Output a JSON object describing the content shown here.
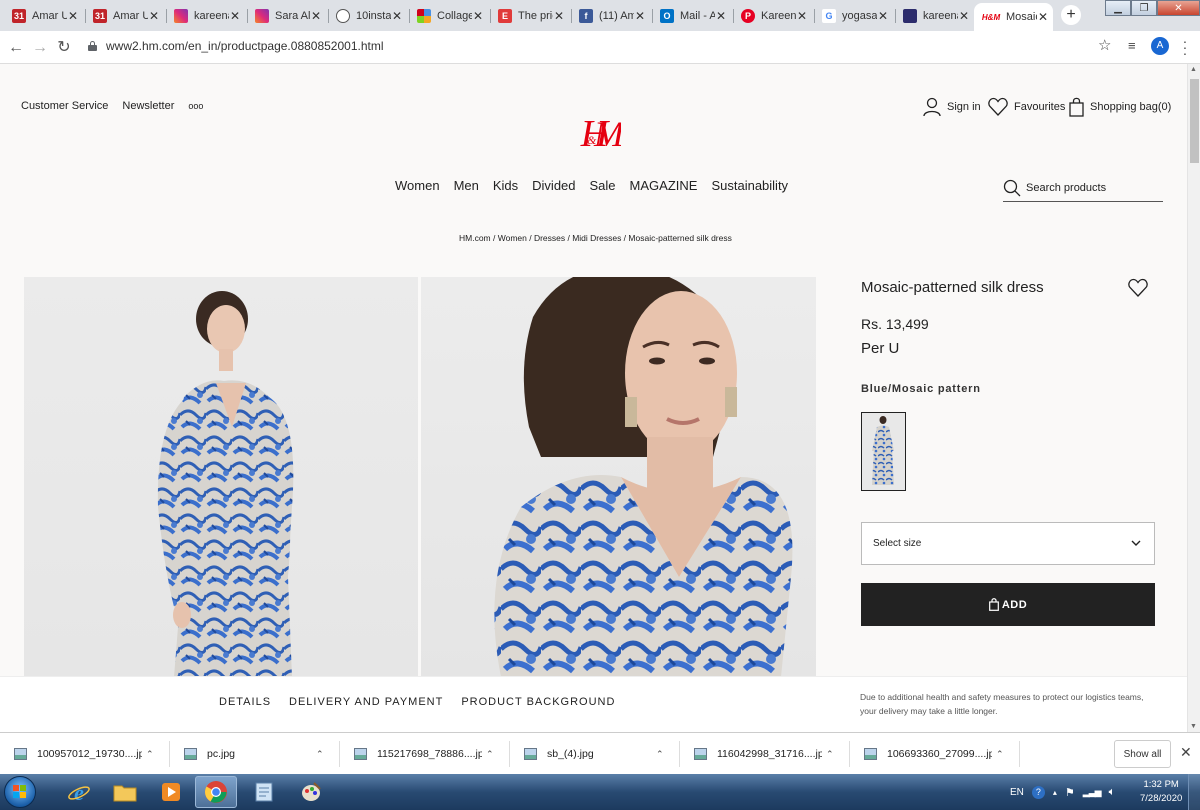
{
  "browser": {
    "tabs": [
      {
        "title": "Amar Uj",
        "fav": "31",
        "favcolor": "#c0242a"
      },
      {
        "title": "Amar Uj",
        "fav": "31",
        "favcolor": "#c0242a"
      },
      {
        "title": "kareena",
        "fav": "",
        "favcolor": "#c13584"
      },
      {
        "title": "Sara Ali",
        "fav": "",
        "favcolor": "#c13584"
      },
      {
        "title": "10insta",
        "fav": "",
        "favcolor": "#555555"
      },
      {
        "title": "Collage",
        "fav": "",
        "favcolor": "#4a90e2"
      },
      {
        "title": "The pric",
        "fav": "E",
        "favcolor": "#e03a3a"
      },
      {
        "title": "(11) Am",
        "fav": "f",
        "favcolor": "#3b5998"
      },
      {
        "title": "Mail - A",
        "fav": "O",
        "favcolor": "#0072c6"
      },
      {
        "title": "Kareena",
        "fav": "P",
        "favcolor": "#e60023"
      },
      {
        "title": "yogasan",
        "fav": "G",
        "favcolor": "#ffffff"
      },
      {
        "title": "kareena",
        "fav": "",
        "favcolor": "#2c2c6c"
      },
      {
        "title": "Mosaic-",
        "fav": "H&M",
        "favcolor": "#ffffff"
      }
    ],
    "url": "www2.hm.com/en_in/productpage.0880852001.html",
    "profile_initial": "A"
  },
  "header": {
    "customer_service": "Customer Service",
    "newsletter": "Newsletter",
    "more": "ooo",
    "logo_alt": "H&M",
    "sign_in": "Sign in",
    "favourites": "Favourites",
    "shopping_bag": "Shopping bag(0)"
  },
  "nav": {
    "items": [
      "Women",
      "Men",
      "Kids",
      "Divided",
      "Sale",
      "MAGAZINE",
      "Sustainability"
    ],
    "search_placeholder": "Search products"
  },
  "breadcrumb": "HM.com / Women / Dresses / Midi Dresses / Mosaic-patterned silk dress",
  "product": {
    "title": "Mosaic-patterned silk dress",
    "price": "Rs. 13,499",
    "unit": "Per U",
    "color_name": "Blue/Mosaic pattern",
    "size_placeholder": "Select size",
    "add_label": "ADD"
  },
  "bottom": {
    "tabs": [
      "DETAILS",
      "DELIVERY AND PAYMENT",
      "PRODUCT BACKGROUND"
    ],
    "notice": "Due to additional health and safety measures to protect our logistics teams, your delivery may take a little longer."
  },
  "downloads": {
    "items": [
      "100957012_19730....jpg",
      "pc.jpg",
      "115217698_78886....jpg",
      "sb_(4).jpg",
      "116042998_31716....jpg",
      "106693360_27099....jpg"
    ],
    "show_all": "Show all"
  },
  "taskbar": {
    "lang": "EN",
    "time": "1:32 PM",
    "date": "7/28/2020"
  },
  "colors": {
    "brand_red": "#e50010",
    "add_button": "#222222",
    "page_bg": "#faf9f8"
  }
}
